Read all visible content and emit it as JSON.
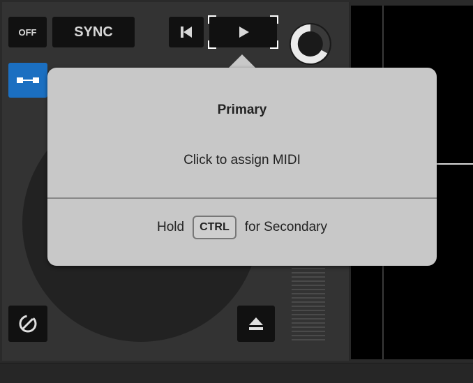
{
  "deck": {
    "off_label": "OFF",
    "sync_label": "SYNC"
  },
  "tooltip": {
    "title": "Primary",
    "action": "Click to assign MIDI",
    "hold_label": "Hold",
    "key_label": "CTRL",
    "secondary_label": "for Secondary"
  },
  "icons": {
    "prev": "skip-back-icon",
    "play": "play-icon",
    "knob": "gain-knob",
    "link": "link-icon",
    "keylock": "keylock-icon",
    "eject": "eject-icon"
  },
  "colors": {
    "accent": "#1b6fc1",
    "tooltip_bg": "#c8c8c8"
  }
}
